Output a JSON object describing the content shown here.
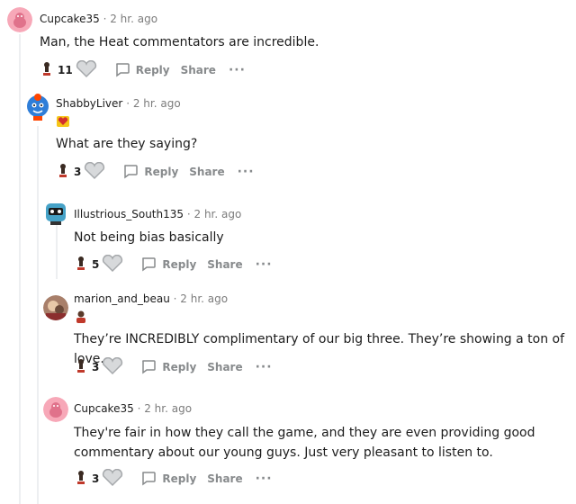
{
  "comments": [
    {
      "username": "Cupcake35",
      "time": "2 hr. ago",
      "text": "Man, the Heat commentators are incredible.",
      "votes": "11"
    },
    {
      "username": "ShabbyLiver",
      "time": "2 hr. ago",
      "text": "What are they saying?",
      "votes": "3"
    },
    {
      "username": "Illustrious_South135",
      "time": "2 hr. ago",
      "text": "Not being bias basically",
      "votes": "5"
    },
    {
      "username": "marion_and_beau",
      "time": "2 hr. ago",
      "text": "They’re INCREDIBLY complimentary of our big three. They’re showing a ton of love.",
      "votes": "3"
    },
    {
      "username": "Cupcake35",
      "time": "2 hr. ago",
      "text": "They're fair in how they call the game, and they are even providing good commentary about our young guys. Just very pleasant to listen to.",
      "votes": "3"
    }
  ],
  "labels": {
    "separator": "·",
    "reply": "Reply",
    "share": "Share",
    "more": "···"
  },
  "colors": {
    "pink_avatar": "#f7a8b8",
    "meta": "#7c7c7c",
    "action": "#878a8c",
    "thread": "#edeff1"
  }
}
